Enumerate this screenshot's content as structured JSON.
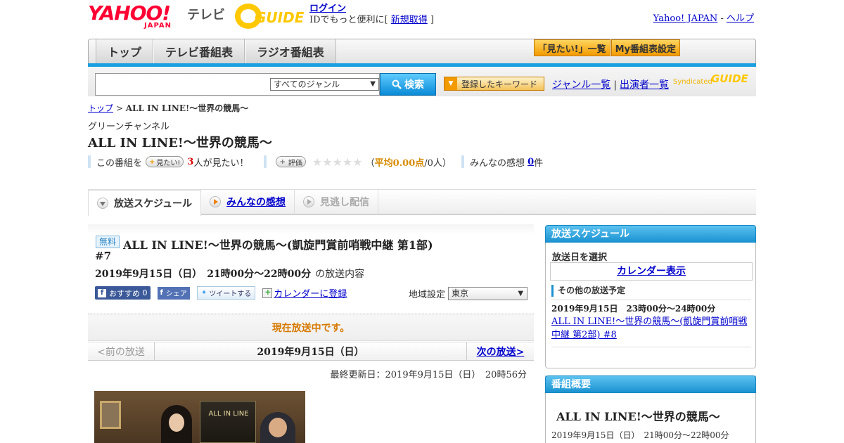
{
  "header": {
    "logo_main": "YAHOO!",
    "logo_sub": "JAPAN",
    "logo_tv": "テレビ",
    "logo_partner": "GUIDE",
    "login_label": "ログイン",
    "login_tagline": "IDでもっと便利に[",
    "signup_label": "新規取得",
    "signup_suffix": "]",
    "yahoo_japan_link": "Yahoo! JAPAN",
    "separator": "-",
    "help_link": "ヘルプ"
  },
  "nav": {
    "tabs": [
      {
        "label": "トップ"
      },
      {
        "label": "テレビ番組表"
      },
      {
        "label": "ラジオ番組表"
      }
    ],
    "watchlist_button": "「見たい!」一覧",
    "my_schedule_button": "My番組表設定"
  },
  "search": {
    "input_value": "",
    "genre_select": "すべてのジャンル",
    "search_button": "検索",
    "keyword_button": "登録したキーワード",
    "genre_list_link": "ジャンル一覧",
    "performer_list_link": "出演者一覧",
    "link_separator": "|",
    "syndicated_label": "Syndicated",
    "syndicated_logo": "GUIDE"
  },
  "breadcrumb": {
    "top": "トップ",
    "sep": ">",
    "current": "ALL IN LINE!～世界の競馬～"
  },
  "program": {
    "channel": "グリーンチャンネル",
    "title": "ALL IN LINE!～世界の競馬～",
    "want_prefix": "この番組を",
    "want_button": "見たい!",
    "want_count": "3",
    "want_suffix": "人が見たい！",
    "rate_button": "評価",
    "stars": "★★★★★",
    "avg_open": "（",
    "avg_value": "平均0.00点",
    "avg_rest": "/0人）",
    "impressions_label": "みんなの感想",
    "impressions_count": "0",
    "impressions_unit": "件"
  },
  "tabs": [
    {
      "label": "放送スケジュール"
    },
    {
      "label": "みんなの感想"
    },
    {
      "label": "見逃し配信"
    }
  ],
  "broadcast": {
    "free_badge": "無料",
    "title": "ALL IN LINE!～世界の競馬～(凱旋門賞前哨戦中継 第1部)",
    "episode": "#7",
    "datetime": "2019年9月15日（日）　21時00分～22時00分",
    "datetime_suffix": "の放送内容",
    "fb_recommend": "おすすめ",
    "fb_count": "0",
    "fb_share": "シェア",
    "tweet": "ツイートする",
    "calendar_link": "カレンダーに登録",
    "region_label": "地域設定",
    "region_value": "東京",
    "live_status": "現在放送中です。",
    "prev_label": "<前の放送",
    "current_date": "2019年9月15日（日）",
    "next_label": "次の放送>",
    "updated": "最終更新日：2019年9月15日（日）　20時56分",
    "image_caption": "ALL IN LINE"
  },
  "sidebar": {
    "schedule_head": "放送スケジュール",
    "select_date": "放送日を選択",
    "calendar_button": "カレンダー表示",
    "other_head": "その他の放送予定",
    "other_time": "2019年9月15日　23時00分～24時00分",
    "other_link": "ALL IN LINE!～世界の競馬～(凱旋門賞前哨戦中継 第2部) #8",
    "summary_head": "番組概要",
    "summary_title": "ALL IN LINE!～世界の競馬～",
    "summary_time": "2019年9月15日（日）　21時00分～22時00分"
  },
  "colors": {
    "brand_red": "#ff0033",
    "accent_blue": "#1a9fe0",
    "gguide_yellow": "#ffc800",
    "live_orange": "#d77a00"
  }
}
